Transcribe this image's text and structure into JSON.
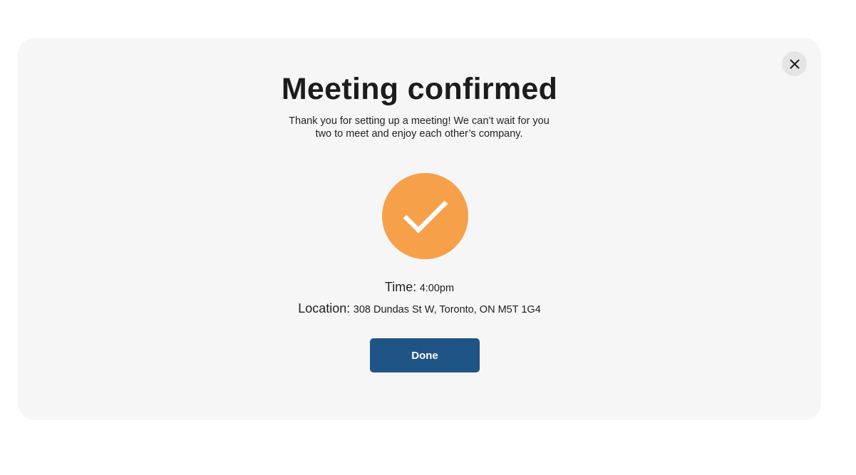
{
  "modal": {
    "title": "Meeting confirmed",
    "subtitle": "Thank you for setting up a meeting! We can’t wait for you two to meet and enjoy each other’s company.",
    "close_icon": "close-icon",
    "status_icon": "checkmark-icon",
    "details": {
      "time_label": "Time:",
      "time_value": "4:00pm",
      "location_label": "Location:",
      "location_value": "308 Dundas St W, Toronto, ON M5T 1G4"
    },
    "done_label": "Done"
  },
  "colors": {
    "modal_background": "#f6f6f6",
    "accent_orange": "#f7a04a",
    "button_blue": "#1f5486",
    "close_button_bg": "#e4e4e4"
  }
}
